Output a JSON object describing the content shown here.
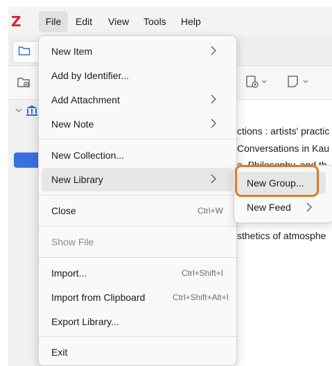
{
  "menubar": {
    "logo": "Z",
    "items": [
      "File",
      "Edit",
      "View",
      "Tools",
      "Help"
    ]
  },
  "right_pane": {
    "rows": [
      "ctions : artists' practic",
      "Conversations in Kau",
      "e, Philosophy, and th",
      "sthetics of atmosphe"
    ]
  },
  "file_menu": {
    "items": [
      {
        "label": "New Item",
        "submenu": true
      },
      {
        "label": "Add by Identifier...",
        "submenu": false
      },
      {
        "label": "Add Attachment",
        "submenu": true
      },
      {
        "label": "New Note",
        "submenu": true
      },
      {
        "label": "New Collection...",
        "submenu": false
      },
      {
        "label": "New Library",
        "submenu": true
      },
      {
        "label": "Close",
        "shortcut": "Ctrl+W"
      },
      {
        "label": "Show File",
        "disabled": true
      },
      {
        "label": "Import...",
        "shortcut": "Ctrl+Shift+I"
      },
      {
        "label": "Import from Clipboard",
        "shortcut": "Ctrl+Shift+Alt+I"
      },
      {
        "label": "Export Library..."
      },
      {
        "label": "Exit"
      }
    ]
  },
  "new_library_submenu": {
    "items": [
      {
        "label": "New Group..."
      },
      {
        "label": "New Feed",
        "submenu": true
      }
    ]
  },
  "colors": {
    "accent_highlight": "#e07820",
    "logo_red": "#d7263d",
    "blue_button": "#3a6fe0"
  }
}
